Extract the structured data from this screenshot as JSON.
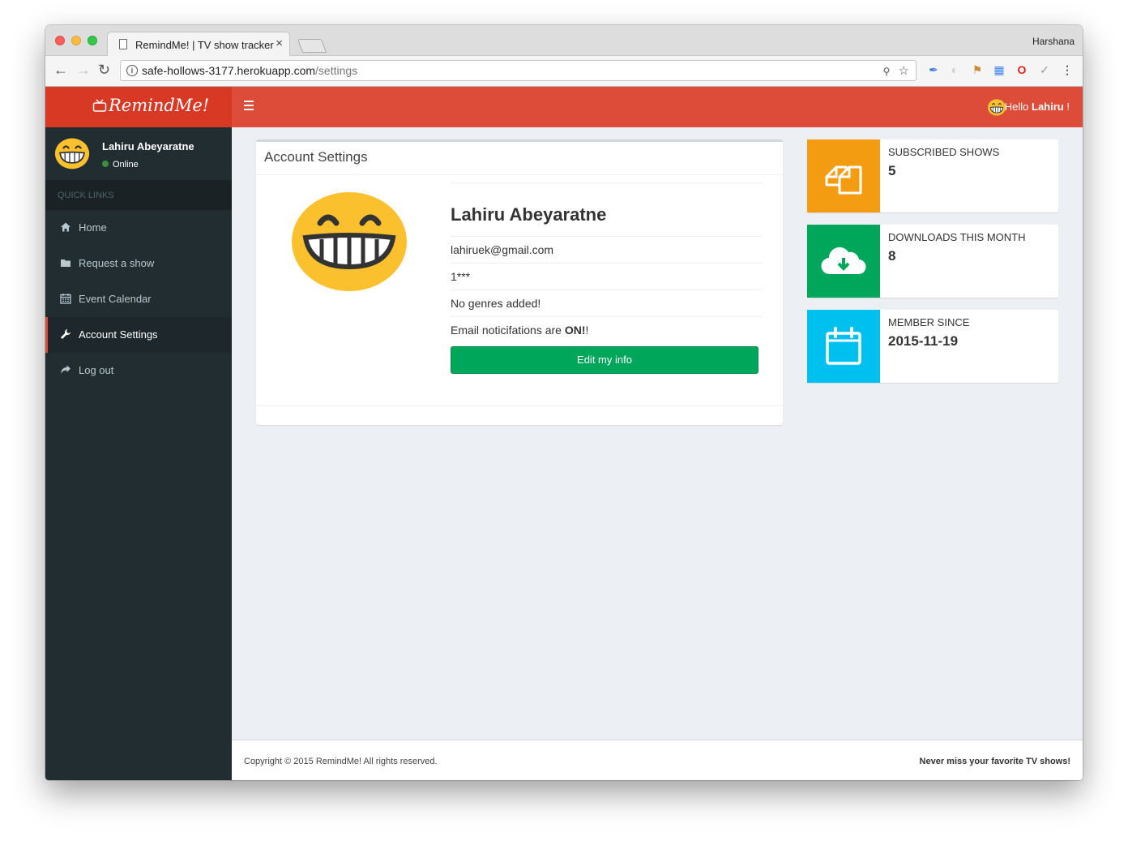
{
  "browser": {
    "tab_title": "RemindMe! | TV show tracker",
    "tab_close": "×",
    "profile_name": "Harshana",
    "url_host": "safe-hollows-3177.herokuapp.com",
    "url_path": "/settings"
  },
  "app": {
    "logo_text": "RemindMe!",
    "header": {
      "hello_prefix": "Hello",
      "hello_name": "Lahiru",
      "hello_suffix": "!"
    },
    "sidebar": {
      "user_name": "Lahiru Abeyaratne",
      "user_status": "Online",
      "quick_links_header": "QUICK LINKS",
      "items": [
        {
          "label": "Home",
          "icon": "home-icon"
        },
        {
          "label": "Request a show",
          "icon": "folder-icon"
        },
        {
          "label": "Event Calendar",
          "icon": "calendar-icon"
        },
        {
          "label": "Account Settings",
          "icon": "wrench-icon",
          "active": true
        },
        {
          "label": "Log out",
          "icon": "share-icon"
        }
      ]
    },
    "account": {
      "box_title": "Account Settings",
      "name": "Lahiru Abeyaratne",
      "email": "lahiruek@gmail.com",
      "password_masked": "1***",
      "genres": "No genres added!",
      "email_notif_prefix": "Email noticifations are",
      "email_notif_value": "ON!",
      "email_notif_suffix": "!",
      "edit_button": "Edit my info"
    },
    "info_boxes": [
      {
        "label": "SUBSCRIBED SHOWS",
        "value": "5",
        "color": "#f39c12",
        "icon": "files-icon"
      },
      {
        "label": "DOWNLOADS THIS MONTH",
        "value": "8",
        "color": "#00a65a",
        "icon": "cloud-download-icon"
      },
      {
        "label": "MEMBER SINCE",
        "value": "2015-11-19",
        "color": "#00c0ef",
        "icon": "calendar-icon"
      }
    ],
    "footer": {
      "copyright": "Copyright © 2015 RemindMe! All rights reserved.",
      "tagline": "Never miss your favorite TV shows!"
    }
  },
  "colors": {
    "header_red": "#dd4b39",
    "logo_red": "#d73925",
    "sidebar_dark": "#222d32",
    "content_bg": "#ecf0f5"
  }
}
